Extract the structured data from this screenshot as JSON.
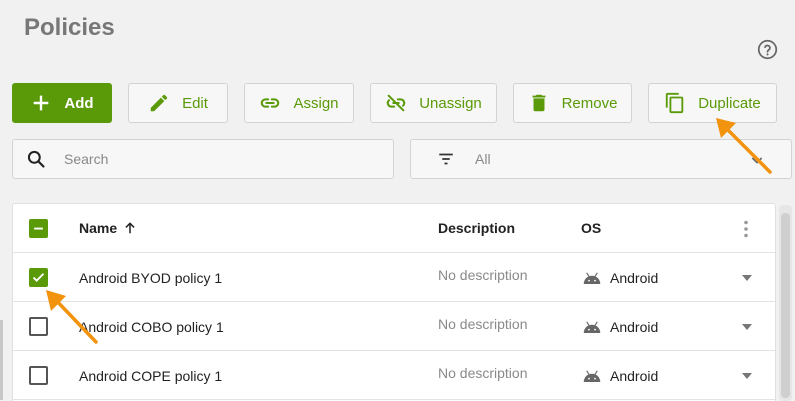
{
  "page": {
    "title": "Policies"
  },
  "icons": {
    "help": "help-circle-icon"
  },
  "toolbar": {
    "add": "Add",
    "edit": "Edit",
    "assign": "Assign",
    "unassign": "Unassign",
    "remove": "Remove",
    "duplicate": "Duplicate"
  },
  "search": {
    "placeholder": "Search",
    "value": ""
  },
  "filter": {
    "selected": "All"
  },
  "table": {
    "columns": {
      "name": "Name",
      "description": "Description",
      "os": "OS"
    },
    "sort": {
      "column": "Name",
      "direction": "ascending"
    },
    "rows": [
      {
        "name": "Android BYOD policy 1",
        "description": "No description",
        "os": "Android",
        "checked": true
      },
      {
        "name": "Android COBO policy 1",
        "description": "No description",
        "os": "Android",
        "checked": false
      },
      {
        "name": "Android COPE policy 1",
        "description": "No description",
        "os": "Android",
        "checked": false
      }
    ]
  },
  "colors": {
    "accent": "#5a9a08",
    "annotation_arrow": "#f2930d"
  }
}
